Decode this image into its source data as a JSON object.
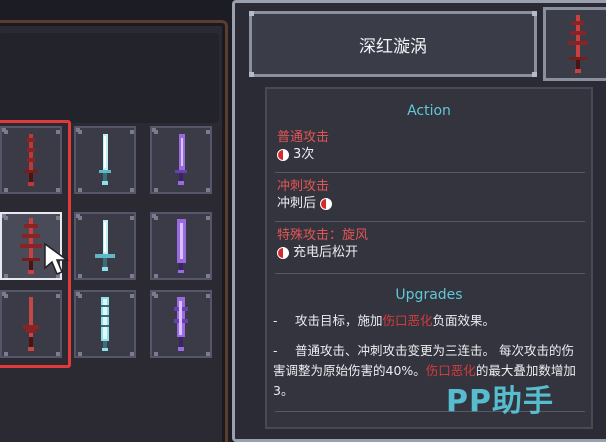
{
  "weapon": {
    "name": "深红漩涡"
  },
  "action": {
    "header": "Action",
    "entries": [
      {
        "name": "普通攻击",
        "desc": "3次"
      },
      {
        "name": "冲刺攻击",
        "desc": "冲刺后"
      },
      {
        "name": "特殊攻击：旋风",
        "desc": "充电后松开"
      }
    ]
  },
  "upgrades": {
    "header": "Upgrades",
    "items": [
      {
        "dash": "-",
        "pre": "攻击目标，施加",
        "hl": "伤口恶化",
        "post": "负面效果。"
      },
      {
        "dash": "-",
        "pre": "普通攻击、冲刺攻击变更为三连击。 每次攻击的伤害调整为原始伤害的40%。",
        "hl": "伤口恶化",
        "post": "的最大叠加数增加3。"
      }
    ]
  },
  "watermark": "PP助手",
  "colors": {
    "accent_red": "#e03a3a",
    "section_cyan": "#5fc9d8",
    "panel": "#2a2b34"
  },
  "icons": {
    "slots": [
      "red-spiral-sword-icon",
      "cyan-sword-icon",
      "purple-sword-icon",
      "red-spiral-sword-icon",
      "cyan-sword-icon",
      "purple-sword-icon",
      "red-sword-icon",
      "cyan-serrated-sword-icon",
      "purple-serrated-sword-icon"
    ],
    "cursor": "pointer-icon"
  }
}
